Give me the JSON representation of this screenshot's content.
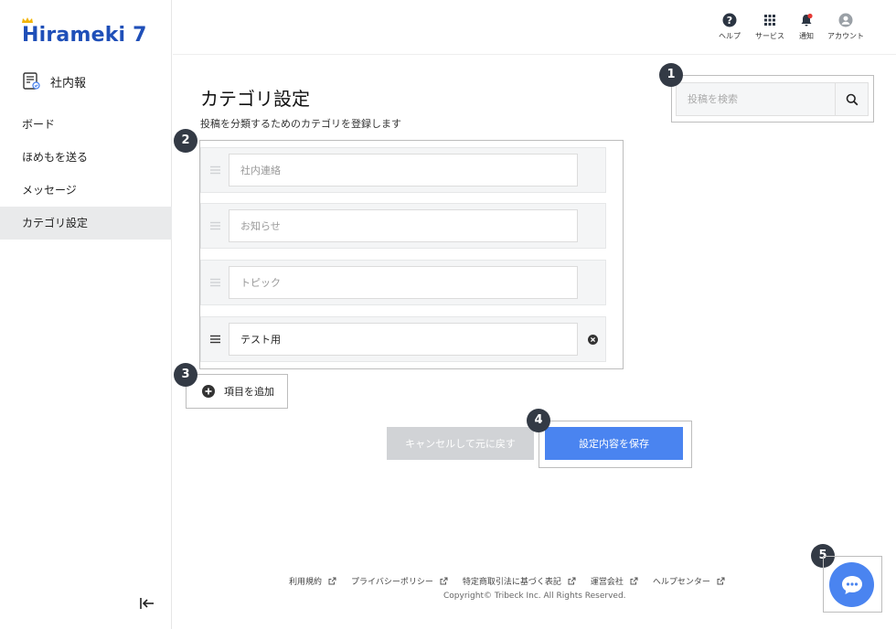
{
  "sidebar": {
    "logo_text": "Hirameki 7",
    "app_name": "社内報",
    "items": [
      {
        "label": "ボード"
      },
      {
        "label": "ほめもを送る"
      },
      {
        "label": "メッセージ"
      },
      {
        "label": "カテゴリ設定",
        "active": true
      }
    ],
    "collapse_icon": "collapse-left-icon"
  },
  "header": {
    "buttons": [
      {
        "label": "ヘルプ",
        "icon": "help-icon"
      },
      {
        "label": "サービス",
        "icon": "grid-icon"
      },
      {
        "label": "通知",
        "icon": "bell-icon"
      },
      {
        "label": "アカウント",
        "icon": "account-icon"
      }
    ]
  },
  "main": {
    "title": "カテゴリ設定",
    "description": "投稿を分類するためのカテゴリを登録します",
    "search": {
      "placeholder": "投稿を検索",
      "value": ""
    },
    "categories": [
      {
        "placeholder": "社内連絡",
        "value": ""
      },
      {
        "placeholder": "お知らせ",
        "value": ""
      },
      {
        "placeholder": "トピック",
        "value": ""
      },
      {
        "placeholder": "",
        "value": "テスト用"
      }
    ],
    "add_label": "項目を追加",
    "cancel_label": "キャンセルして元に戻す",
    "save_label": "設定内容を保存"
  },
  "badges": [
    "1",
    "2",
    "3",
    "4",
    "5"
  ],
  "footer": {
    "links": [
      "利用規約",
      "プライバシーポリシー",
      "特定商取引法に基づく表記",
      "運営会社",
      "ヘルプセンター"
    ],
    "copyright": "Copyright© Tribeck Inc. All Rights Reserved."
  },
  "colors": {
    "brand": "#1f4fb8",
    "primary": "#4a84f0",
    "badge": "#333a45",
    "disabled": "#d1d3d6",
    "notification_dot": "#e53935"
  }
}
